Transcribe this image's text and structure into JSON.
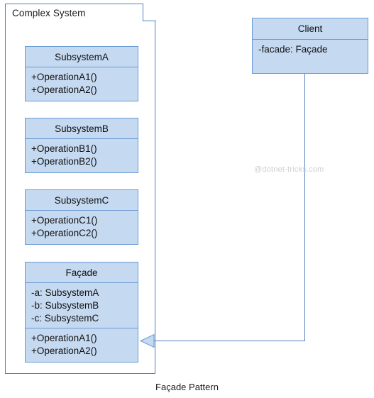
{
  "diagram": {
    "caption": "Façade Pattern",
    "watermark": "@dotnet-tricks.com",
    "colors": {
      "box_fill": "#c5d9f1",
      "box_border": "#6a9ad4",
      "frame_border": "#4f81bd",
      "connector": "#4f81bd",
      "text": "#111111",
      "watermark": "#cfcfcf",
      "background": "#ffffff"
    },
    "package": {
      "label": "Complex System"
    },
    "classes": {
      "subsystem_a": {
        "title": "SubsystemA",
        "operations": [
          "+OperationA1()",
          "+OperationA2()"
        ]
      },
      "subsystem_b": {
        "title": "SubsystemB",
        "operations": [
          "+OperationB1()",
          "+OperationB2()"
        ]
      },
      "subsystem_c": {
        "title": "SubsystemC",
        "operations": [
          "+OperationC1()",
          "+OperationC2()"
        ]
      },
      "facade": {
        "title": "Façade",
        "attributes": [
          "-a: SubsystemA",
          "-b: SubsystemB",
          "-c: SubsystemC"
        ],
        "operations": [
          "+OperationA1()",
          "+OperationA2()"
        ]
      },
      "client": {
        "title": "Client",
        "attributes": [
          "-facade: Façade"
        ]
      }
    },
    "relationship": {
      "from": "Client",
      "to": "Façade",
      "arrow": "hollow-triangle-left"
    }
  }
}
